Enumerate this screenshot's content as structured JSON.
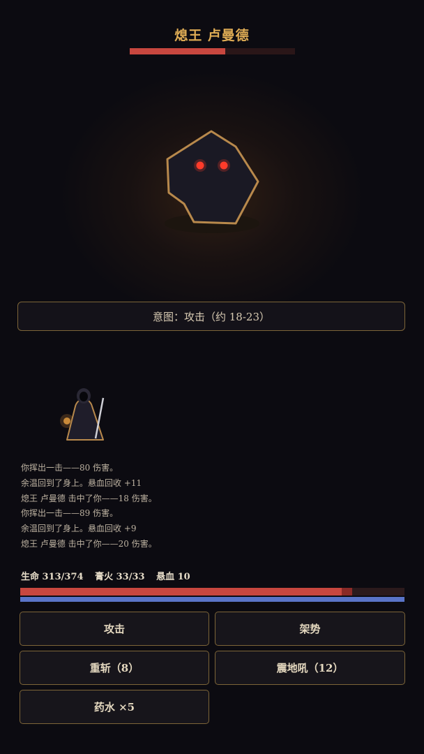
{
  "boss": {
    "name": "熄王 卢曼德",
    "hp_fraction": 0.58
  },
  "intent": {
    "text": "意图：攻击（约 18-23）"
  },
  "log": [
    "你挥出一击——80 伤害。",
    "余温回到了身上。悬血回收 +11",
    "熄王 卢曼德 击中了你——18 伤害。",
    "你挥出一击——89 伤害。",
    "余温回到了身上。悬血回收 +9",
    "熄王 卢曼德 击中了你——20 伤害。"
  ],
  "player": {
    "hp_text": "生命 313/374",
    "fire_text": "膏火 33/33",
    "hang_text": "悬血 10",
    "hp_current": 313,
    "hp_max": 374,
    "hang_blood": 10,
    "fire_current": 33,
    "fire_max": 33
  },
  "actions": {
    "attack": "攻击",
    "stance": "架势",
    "heavy": "重斩（8）",
    "quake": "震地吼（12）",
    "potion": "药水 ×5"
  },
  "colors": {
    "accent_gold": "#e0ad55",
    "hp_red": "#c8473f",
    "hang_red": "#8a2a27",
    "fire_blue": "#5a74c8",
    "eye_red": "#ff3b2a"
  }
}
